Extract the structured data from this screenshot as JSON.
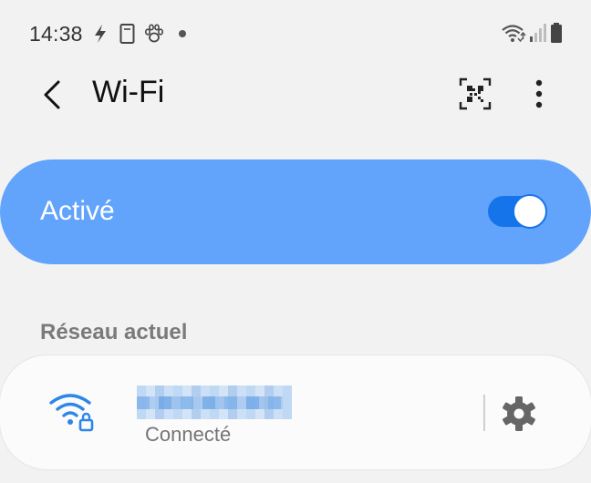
{
  "status_bar": {
    "time": "14:38",
    "icons": [
      "charging-bolt-icon",
      "sim-card-icon",
      "paw-icon",
      "notification-dot-icon",
      "wifi-signal-icon",
      "cell-signal-icon",
      "battery-icon"
    ]
  },
  "header": {
    "title": "Wi-Fi",
    "back_icon": "back-arrow-icon",
    "qr_icon": "qr-code-icon",
    "more_icon": "more-options-icon"
  },
  "master_switch": {
    "label": "Activé",
    "state": "on",
    "accent_color": "#62a3fb",
    "toggle_color": "#1674ea"
  },
  "current_network": {
    "section_title": "Réseau actuel",
    "ssid": "",
    "status": "Connecté",
    "icon": "wifi-lock-icon",
    "settings_icon": "gear-icon"
  }
}
